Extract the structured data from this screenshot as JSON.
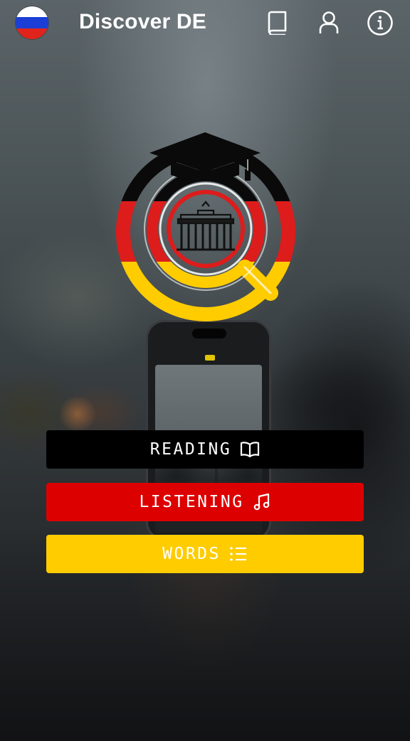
{
  "header": {
    "title": "Discover DE",
    "language_flag": "flag-ru-icon",
    "actions": [
      {
        "name": "book-icon"
      },
      {
        "name": "user-icon"
      },
      {
        "name": "info-icon"
      }
    ]
  },
  "logo": {
    "icon": "graduation-cap-magnifier-brandenburg-gate-logo",
    "colors": [
      "#000000",
      "#dd0000",
      "#ffcc00"
    ]
  },
  "menu": {
    "reading": {
      "label": "READING",
      "icon": "open-book-icon",
      "color": "#000000"
    },
    "listening": {
      "label": "LISTENING",
      "icon": "music-note-icon",
      "color": "#dd0000"
    },
    "words": {
      "label": "WORDS",
      "icon": "list-icon",
      "color": "#ffcc00"
    }
  },
  "theme": {
    "text_color": "#ffffff"
  }
}
